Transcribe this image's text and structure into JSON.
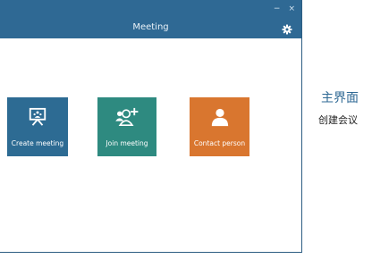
{
  "window": {
    "title": "Meeting",
    "minimize_glyph": "−",
    "close_glyph": "×",
    "settings_icon": "gear-icon"
  },
  "tiles": [
    {
      "label": "Create meeting",
      "icon": "presentation-board-icon",
      "color": "#2d6b93"
    },
    {
      "label": "Join meeting",
      "icon": "add-user-icon",
      "color": "#2e8a80"
    },
    {
      "label": "Contact person",
      "icon": "person-icon",
      "color": "#d9762f"
    }
  ],
  "caption": {
    "title": "主界面",
    "subtitle": "创建会议"
  },
  "colors": {
    "title_bar": "#2f6994",
    "caption_accent": "#2f6994"
  }
}
